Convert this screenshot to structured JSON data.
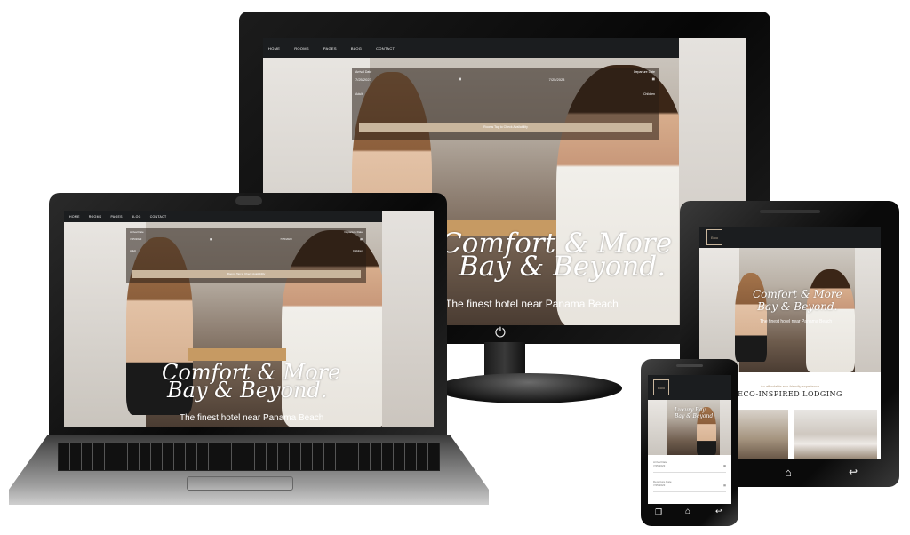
{
  "site": {
    "nav": [
      "HOME",
      "ROOMS",
      "PAGES",
      "BLOG",
      "CONTACT"
    ],
    "arrival_label": "Arrival Date",
    "arrival_value": "7/25/2023",
    "departure_label": "Departure Date",
    "departure_value": "7/25/2023",
    "adult_label": "Adult",
    "children_label": "Children",
    "cta": "Rooms Tap to Check Availability",
    "hero_line1": "Comfort & More",
    "hero_line2": "Bay & Beyond.",
    "hero_sub": "The finest hotel near Panama Beach",
    "section_kicker": "ECO-INSPIRED LODGING",
    "tablet_kicker": "An affordable eco-friendly experience",
    "mobile_hero_line1": "Luxury Bay",
    "mobile_hero_line2": "Bay & Beyond",
    "logo_text": "Ecco"
  },
  "icons": {
    "calendar": "calendar-icon",
    "power": "power-icon",
    "home": "home-icon",
    "back": "back-icon",
    "next": "chevron-right-icon"
  },
  "colors": {
    "accent": "#c9b69d",
    "nav_bg": "#1b1d1f",
    "device": "#0d0d0d"
  }
}
